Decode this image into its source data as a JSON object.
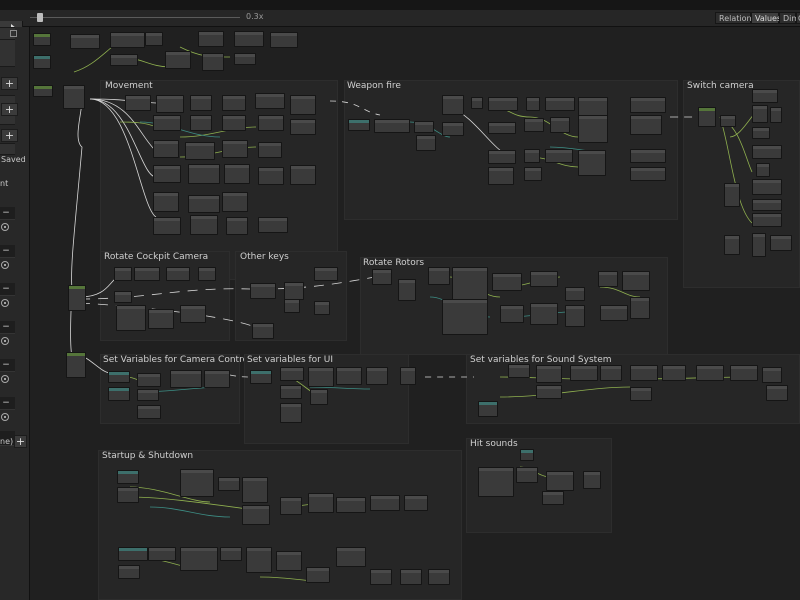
{
  "toolbar": {
    "zoom_label": "0.3x",
    "tabs": [
      "Relations",
      "Values",
      "Dim",
      "G"
    ],
    "active_tab": "Values"
  },
  "sidebar": {
    "status": "Saved",
    "truncated_label": "nt",
    "bottom_label": "ne)"
  },
  "groups": [
    "Movement",
    "Weapon fire",
    "Switch camera",
    "Rotate Cockpit Camera",
    "Other keys",
    "Rotate Rotors",
    "Set Variables for Camera Control",
    "Set variables for UI",
    "Set variables for Sound System",
    "Hit sounds",
    "Startup & Shutdown"
  ],
  "colors": {
    "canvas": "#202020",
    "group": "#262626",
    "node": "#3a3a3a",
    "wire_control": "#d8d8d8",
    "wire_value": "#8fb04f",
    "wire_data": "#3d8f86"
  },
  "icons": [
    "plus-icon",
    "minus-icon",
    "radio-icon",
    "play-triangle-icon"
  ]
}
